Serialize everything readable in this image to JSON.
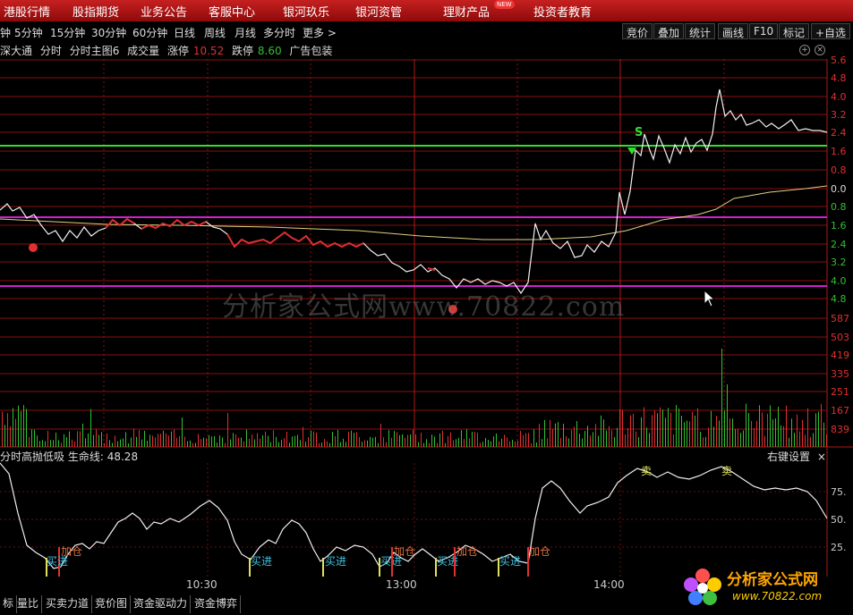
{
  "topbar": {
    "items": [
      "港股行情",
      "股指期货",
      "业务公告",
      "客服中心",
      "银河玖乐",
      "银河资管",
      "理财产品",
      "投资者教育"
    ],
    "new_badge": "NEW"
  },
  "periods": {
    "items": [
      "钟",
      "5分钟",
      "15分钟",
      "30分钟",
      "60分钟",
      "日线",
      "周线",
      "月线",
      "多分时",
      "更多 >"
    ]
  },
  "right_buttons": [
    "竞价",
    "叠加",
    "统计",
    "画线",
    "F10",
    "标记",
    "+自选"
  ],
  "info": {
    "name": "深大通",
    "a": "分时",
    "b": "分时主图6",
    "c": "成交量",
    "limit_up_label": "涨停",
    "limit_up": "10.52",
    "limit_down_label": "跌停",
    "limit_down": "8.60",
    "ad": "广告包装"
  },
  "price_axis": [
    "5.6",
    "4.8",
    "4.0",
    "3.2",
    "2.4",
    "1.6",
    "0.8",
    "0.0",
    "0.8",
    "1.6",
    "2.4",
    "3.2",
    "4.0",
    "4.8"
  ],
  "volume_axis": [
    "587",
    "503",
    "419",
    "335",
    "251",
    "167",
    "839"
  ],
  "indicator_axis": [
    "75.",
    "50.",
    "25."
  ],
  "watermark": "分析家公式网www.70822.com",
  "indicator": {
    "title": "分时高抛低吸",
    "life_line_label": "生命线:",
    "life_line_value": "48.28",
    "setting": "右键设置",
    "close": "×"
  },
  "signals": {
    "add": "加仓",
    "buy": "买进",
    "sell": "卖"
  },
  "price_marks": {
    "sell": "S"
  },
  "times": [
    "10:30",
    "13:00",
    "14:00"
  ],
  "bottom_tabs": [
    "标",
    "量比",
    "买卖力道",
    "竞价图",
    "资金驱动力",
    "资金博弈"
  ],
  "logo": {
    "title": "分析家公式网",
    "url": "www.70822.com"
  },
  "colors": {
    "accent": "#c62020",
    "up": "#e03030",
    "down": "#30c030",
    "support": "#30e030",
    "pressure": "#d020d0",
    "avg": "#e0d080"
  }
}
